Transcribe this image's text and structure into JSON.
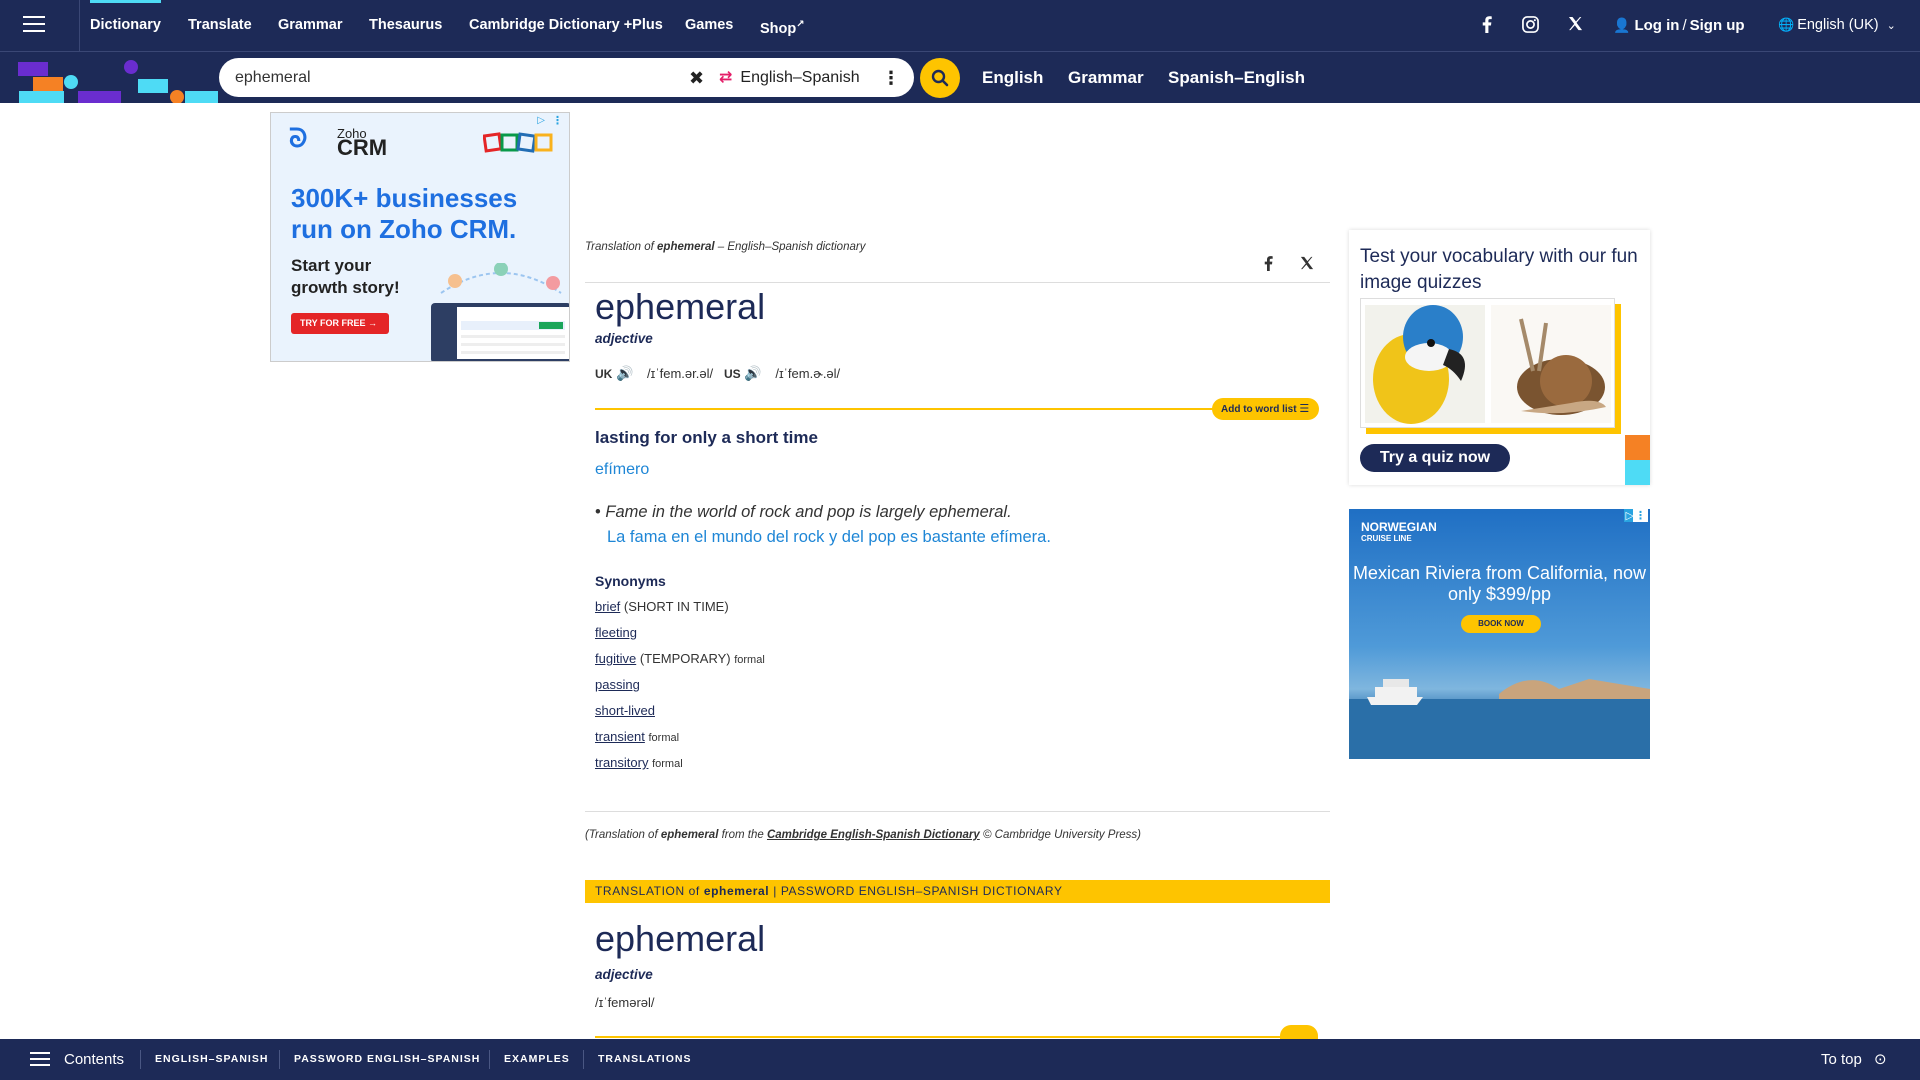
{
  "topnav": {
    "items": [
      "Dictionary",
      "Translate",
      "Grammar",
      "Thesaurus",
      "Cambridge Dictionary +Plus",
      "Games",
      "Shop"
    ],
    "login": "Log in",
    "signup": "Sign up",
    "language": "English (UK)"
  },
  "search": {
    "value": "ephemeral",
    "direction": "English–Spanish",
    "links": [
      "English",
      "Grammar",
      "Spanish–English"
    ]
  },
  "ad_left": {
    "brand_small": "Zoho",
    "brand_big": "CRM",
    "headline": "300K+ businesses run on Zoho CRM.",
    "sub": "Start your growth story!",
    "cta": "TRY FOR FREE →"
  },
  "entry": {
    "crumb_prefix": "Translation of",
    "crumb_word": "ephemeral",
    "crumb_suffix": "– English–Spanish dictionary",
    "headword": "ephemeral",
    "pos": "adjective",
    "uk_label": "UK",
    "uk_ipa": "/ɪˈfem.ər.əl/",
    "us_label": "US",
    "us_ipa": "/ɪˈfem.ɚ.əl/",
    "add_to_word_list": "Add to word list",
    "definition": "lasting for only a short time",
    "translation": "efímero",
    "example_en": "Fame in the world of rock and pop is largely ephemeral.",
    "example_es": "La fama en el mundo del rock y del pop es bastante efímera.",
    "synonyms_title": "Synonyms",
    "synonyms": [
      {
        "word": "brief",
        "note": "(SHORT IN TIME)",
        "register": ""
      },
      {
        "word": "fleeting",
        "note": "",
        "register": ""
      },
      {
        "word": "fugitive",
        "note": "(TEMPORARY)",
        "register": "formal"
      },
      {
        "word": "passing",
        "note": "",
        "register": ""
      },
      {
        "word": "short-lived",
        "note": "",
        "register": ""
      },
      {
        "word": "transient",
        "note": "",
        "register": "formal"
      },
      {
        "word": "transitory",
        "note": "",
        "register": "formal"
      }
    ],
    "credit_prefix": "(Translation of",
    "credit_word": "ephemeral",
    "credit_mid": "from the",
    "credit_link": "Cambridge English-Spanish Dictionary",
    "credit_suffix": "© Cambridge University Press)"
  },
  "password_section": {
    "head_prefix": "TRANSLATION of",
    "head_word": "ephemeral",
    "head_suffix": "| PASSWORD ENGLISH–SPANISH DICTIONARY",
    "headword": "ephemeral",
    "pos": "adjective",
    "ipa": "/ɪˈfemərəl/"
  },
  "quiz": {
    "title": "Test your vocabulary with our fun image quizzes",
    "button": "Try a quiz now"
  },
  "ad_right": {
    "brand": "NORWEGIAN",
    "brand_sub": "CRUISE LINE",
    "text": "Mexican Riviera from California, now only $399/pp",
    "cta": "BOOK NOW"
  },
  "bottombar": {
    "contents": "Contents",
    "links": [
      "ENGLISH–SPANISH",
      "PASSWORD ENGLISH–SPANISH",
      "EXAMPLES",
      "TRANSLATIONS"
    ],
    "to_top": "To top"
  },
  "colors": {
    "navy": "#1d2a57",
    "yellow": "#fec400",
    "link_blue": "#1e86d6",
    "accent_cyan": "#4edbf5"
  }
}
